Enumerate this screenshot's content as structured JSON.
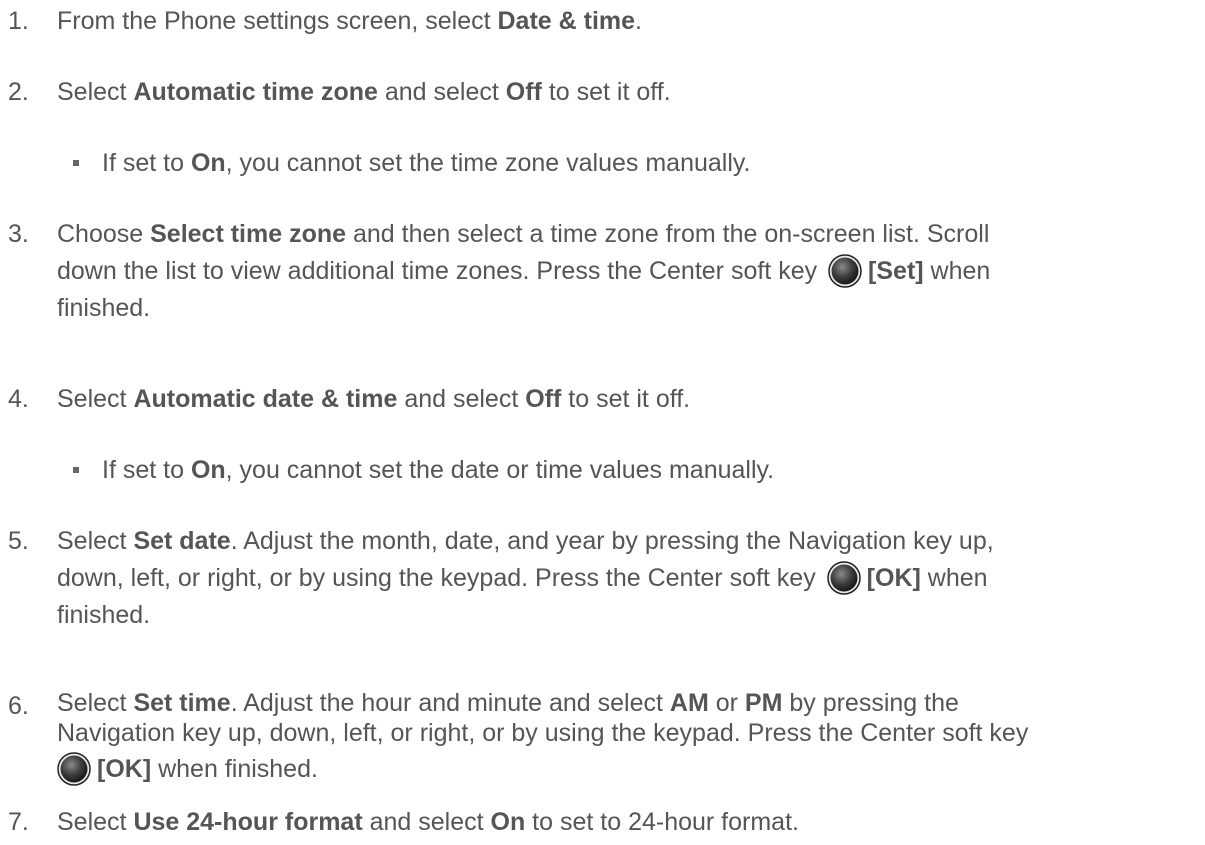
{
  "steps": [
    {
      "num": "1.",
      "parts": [
        "From the Phone settings screen, select ",
        "Date & time",
        "."
      ]
    },
    {
      "num": "2.",
      "parts": [
        "Select ",
        "Automatic time zone",
        " and select ",
        "Off",
        " to set it off."
      ]
    },
    {
      "bullet": true,
      "parts": [
        "If set to ",
        "On",
        ", you cannot set the time zone values manually."
      ]
    },
    {
      "num": "3.",
      "line1": [
        "Choose ",
        "Select time zone",
        " and then select a time zone from the on-screen list. Scroll"
      ],
      "line2": [
        "down the list to view additional time zones. Press the Center soft key ",
        "[Set]",
        " when"
      ],
      "line3": "finished."
    },
    {
      "num": "4.",
      "parts": [
        "Select ",
        "Automatic date & time",
        " and select ",
        "Off",
        " to set it off."
      ]
    },
    {
      "bullet": true,
      "parts": [
        "If set to ",
        "On",
        ", you cannot set the date or time values manually."
      ]
    },
    {
      "num": "5.",
      "line1": [
        "Select ",
        "Set date",
        ". Adjust the month, date, and year by pressing the Navigation key up,"
      ],
      "line2": [
        "down, left, or right, or by using the keypad. Press the Center soft key ",
        "[OK]",
        " when"
      ],
      "line3": "finished."
    },
    {
      "num": "6.",
      "line1": [
        "Select ",
        "Set time",
        ". Adjust the hour and minute and select ",
        "AM",
        " or ",
        "PM",
        " by pressing the"
      ],
      "line2": "Navigation key up, down, left, or right, or by using the keypad. Press the Center soft key",
      "line3": [
        "[OK]",
        " when finished."
      ]
    },
    {
      "num": "7.",
      "parts": [
        "Select ",
        "Use 24-hour format",
        " and select ",
        "On",
        " to set to 24-hour format."
      ]
    }
  ]
}
